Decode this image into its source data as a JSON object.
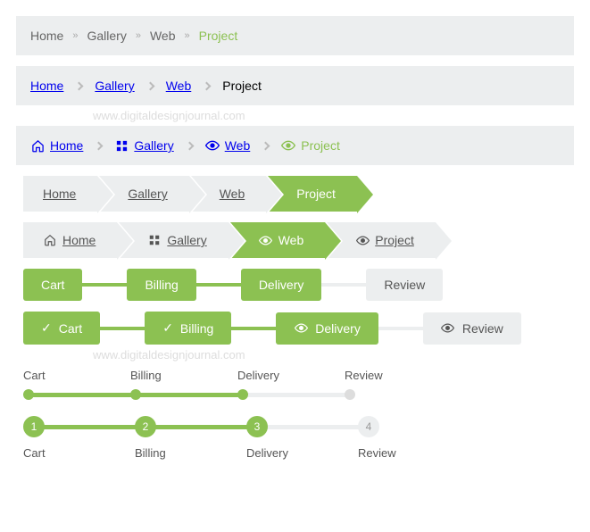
{
  "items": [
    "Home",
    "Gallery",
    "Web",
    "Project"
  ],
  "activeIndex": 3,
  "arrowActive": 2,
  "steps": [
    "Cart",
    "Billing",
    "Delivery",
    "Review"
  ],
  "stepsActive": 2,
  "numbers": [
    "1",
    "2",
    "3",
    "4"
  ],
  "watermark": "www.digitaldesignjournal.com",
  "colors": {
    "accent": "#8CC152",
    "muted": "#eceeef"
  }
}
